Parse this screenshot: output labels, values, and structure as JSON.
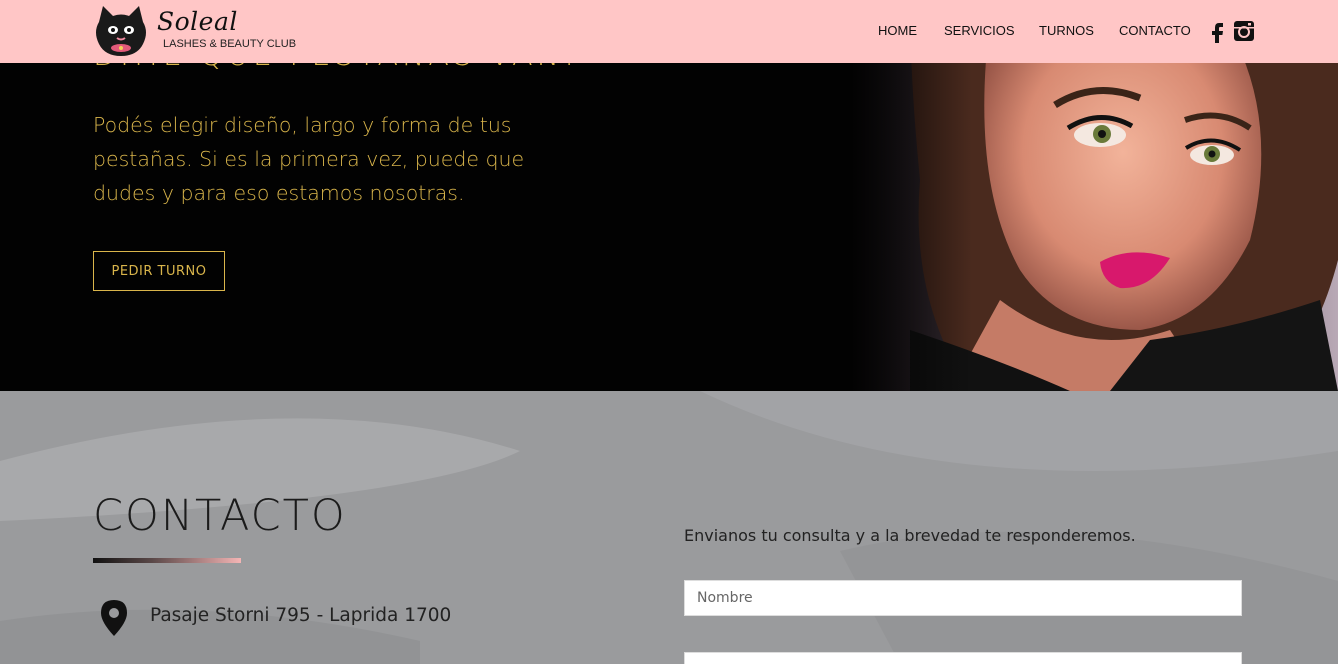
{
  "brand": {
    "name": "Soleal",
    "tagline": "LASHES & BEAUTY CLUB"
  },
  "nav": {
    "items": [
      {
        "label": "HOME"
      },
      {
        "label": "SERVICIOS"
      },
      {
        "label": "TURNOS"
      },
      {
        "label": "CONTACTO"
      }
    ],
    "social": [
      {
        "icon": "facebook-icon"
      },
      {
        "icon": "instagram-icon"
      }
    ]
  },
  "hero": {
    "title_partial": "DIME QUÉ PESTAÑAS VAN!",
    "text": "Podés elegir diseño, largo y forma de tus pestañas. Si es la primera vez, puede que dudes y para eso estamos nosotras.",
    "button_label": "PEDIR TURNO"
  },
  "contact": {
    "title": "CONTACTO",
    "address": "Pasaje Storni 795 - Laprida 1700",
    "form_intro": "Envianos tu consulta y a la brevedad te responderemos.",
    "name_placeholder": "Nombre"
  },
  "colors": {
    "header_bg": "#ffc6c6",
    "accent_gold": "#d9b54b",
    "hero_bg": "#020202",
    "contact_bg": "#9a9b9d"
  }
}
